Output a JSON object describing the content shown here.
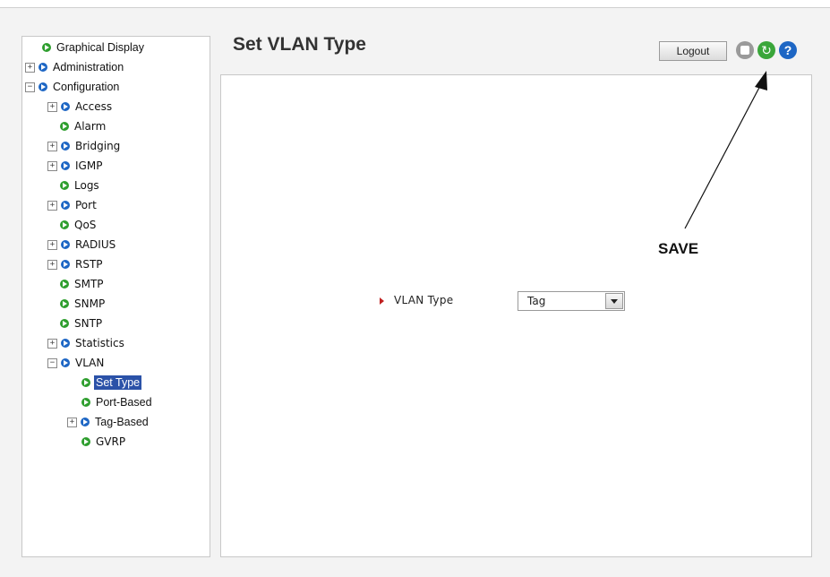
{
  "title": "Set VLAN Type",
  "header": {
    "logout_label": "Logout",
    "save_icon": "save-icon",
    "refresh_icon": "refresh-icon",
    "help_icon": "help-icon"
  },
  "sidebar": {
    "items": [
      {
        "label": "Graphical Display",
        "toggle": "",
        "bullet": "green"
      },
      {
        "label": "Administration",
        "toggle": "+",
        "bullet": "blue"
      },
      {
        "label": "Configuration",
        "toggle": "−",
        "bullet": "blue"
      },
      {
        "label": "Access",
        "toggle": "+",
        "bullet": "blue"
      },
      {
        "label": "Alarm",
        "toggle": "",
        "bullet": "green"
      },
      {
        "label": "Bridging",
        "toggle": "+",
        "bullet": "blue"
      },
      {
        "label": "IGMP",
        "toggle": "+",
        "bullet": "blue"
      },
      {
        "label": "Logs",
        "toggle": "",
        "bullet": "green"
      },
      {
        "label": "Port",
        "toggle": "+",
        "bullet": "blue"
      },
      {
        "label": "QoS",
        "toggle": "",
        "bullet": "green"
      },
      {
        "label": "RADIUS",
        "toggle": "+",
        "bullet": "blue"
      },
      {
        "label": "RSTP",
        "toggle": "+",
        "bullet": "blue"
      },
      {
        "label": "SMTP",
        "toggle": "",
        "bullet": "green"
      },
      {
        "label": "SNMP",
        "toggle": "",
        "bullet": "green"
      },
      {
        "label": "SNTP",
        "toggle": "",
        "bullet": "green"
      },
      {
        "label": "Statistics",
        "toggle": "+",
        "bullet": "blue"
      },
      {
        "label": "VLAN",
        "toggle": "−",
        "bullet": "blue"
      },
      {
        "label": "Set Type",
        "toggle": "",
        "bullet": "green",
        "selected": true
      },
      {
        "label": "Port-Based",
        "toggle": "",
        "bullet": "green"
      },
      {
        "label": "Tag-Based",
        "toggle": "+",
        "bullet": "blue"
      },
      {
        "label": "GVRP",
        "toggle": "",
        "bullet": "green"
      }
    ]
  },
  "form": {
    "vlan_type_label": "VLAN Type",
    "vlan_type_value": "Tag"
  },
  "annotation": {
    "text": "SAVE"
  },
  "colors": {
    "selected_bg": "#2b52a8",
    "green_bullet": "#2e9e2e",
    "blue_bullet": "#1d66c4",
    "marker": "#c02020"
  }
}
